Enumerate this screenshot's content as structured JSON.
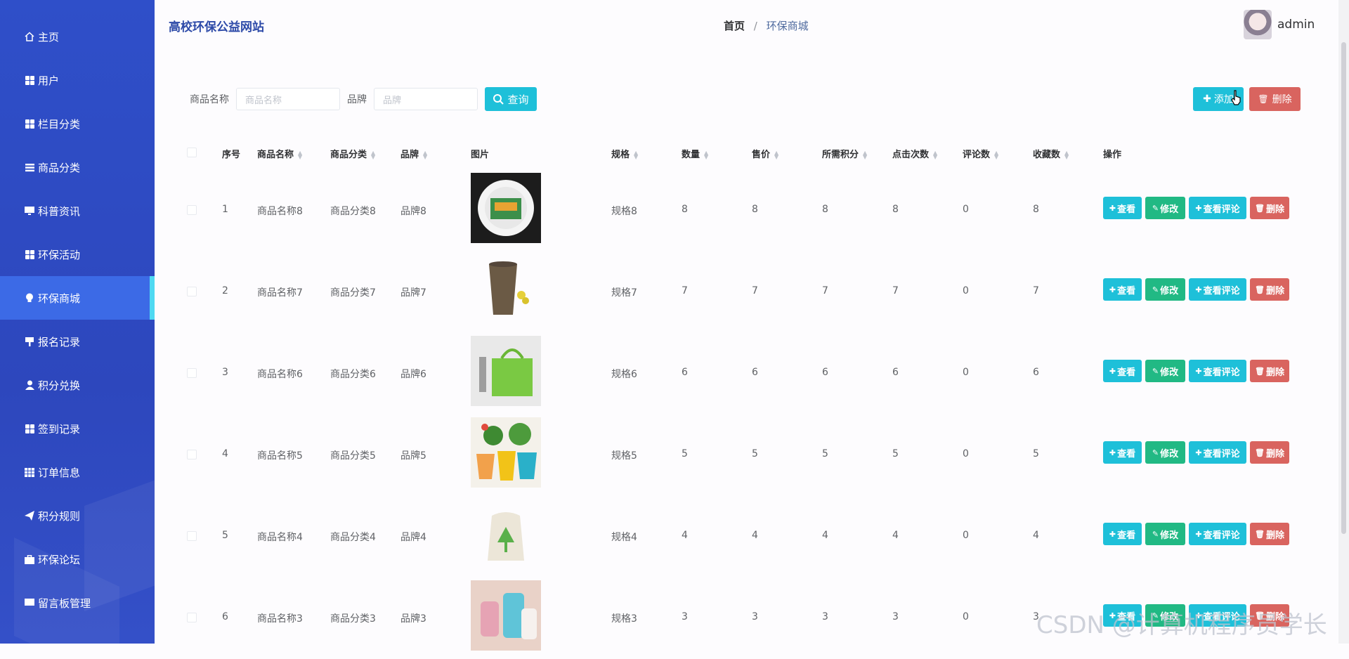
{
  "sidebar": {
    "items": [
      {
        "label": "主页",
        "icon": "home-icon"
      },
      {
        "label": "用户",
        "icon": "grid-icon"
      },
      {
        "label": "栏目分类",
        "icon": "grid-icon"
      },
      {
        "label": "商品分类",
        "icon": "list-icon"
      },
      {
        "label": "科普资讯",
        "icon": "monitor-icon"
      },
      {
        "label": "环保活动",
        "icon": "grid-icon"
      },
      {
        "label": "环保商城",
        "icon": "bulb-icon",
        "active": true
      },
      {
        "label": "报名记录",
        "icon": "flag-icon"
      },
      {
        "label": "积分兑换",
        "icon": "user-icon"
      },
      {
        "label": "签到记录",
        "icon": "grid-icon"
      },
      {
        "label": "订单信息",
        "icon": "table-icon"
      },
      {
        "label": "积分规则",
        "icon": "send-icon"
      },
      {
        "label": "环保论坛",
        "icon": "briefcase-icon"
      },
      {
        "label": "留言板管理",
        "icon": "message-icon"
      }
    ]
  },
  "header": {
    "site_title": "高校环保公益网站",
    "breadcrumb": {
      "home": "首页",
      "separator": "/",
      "current": "环保商城"
    },
    "username": "admin"
  },
  "search": {
    "name_label": "商品名称",
    "name_placeholder": "商品名称",
    "brand_label": "品牌",
    "brand_placeholder": "品牌",
    "query_label": "查询"
  },
  "toolbar": {
    "add_label": "添加",
    "delete_label": "删除"
  },
  "table": {
    "columns": [
      "序号",
      "商品名称",
      "商品分类",
      "品牌",
      "图片",
      "规格",
      "数量",
      "售价",
      "所需积分",
      "点击次数",
      "评论数",
      "收藏数",
      "操作"
    ],
    "rows": [
      {
        "index": "1",
        "name": "商品名称8",
        "category": "商品分类8",
        "brand": "品牌8",
        "spec": "规格8",
        "qty": "8",
        "price": "8",
        "points": "8",
        "clicks": "8",
        "comments": "0",
        "favorites": "8"
      },
      {
        "index": "2",
        "name": "商品名称7",
        "category": "商品分类7",
        "brand": "品牌7",
        "spec": "规格7",
        "qty": "7",
        "price": "7",
        "points": "7",
        "clicks": "7",
        "comments": "0",
        "favorites": "7"
      },
      {
        "index": "3",
        "name": "商品名称6",
        "category": "商品分类6",
        "brand": "品牌6",
        "spec": "规格6",
        "qty": "6",
        "price": "6",
        "points": "6",
        "clicks": "6",
        "comments": "0",
        "favorites": "6"
      },
      {
        "index": "4",
        "name": "商品名称5",
        "category": "商品分类5",
        "brand": "品牌5",
        "spec": "规格5",
        "qty": "5",
        "price": "5",
        "points": "5",
        "clicks": "5",
        "comments": "0",
        "favorites": "5"
      },
      {
        "index": "5",
        "name": "商品名称4",
        "category": "商品分类4",
        "brand": "品牌4",
        "spec": "规格4",
        "qty": "4",
        "price": "4",
        "points": "4",
        "clicks": "4",
        "comments": "0",
        "favorites": "4"
      },
      {
        "index": "6",
        "name": "商品名称3",
        "category": "商品分类3",
        "brand": "品牌3",
        "spec": "规格3",
        "qty": "3",
        "price": "3",
        "points": "3",
        "clicks": "3",
        "comments": "0",
        "favorites": "3"
      }
    ],
    "actions": {
      "view": "查看",
      "edit": "修改",
      "view_comments": "查看评论",
      "delete": "删除"
    }
  },
  "watermark": "CSDN @计算机程序员学长",
  "colors": {
    "sidebar": "#2f4fc9",
    "active": "#3c6ae6",
    "accent": "#1ec0d9",
    "success": "#21b984",
    "danger": "#d9645f"
  }
}
